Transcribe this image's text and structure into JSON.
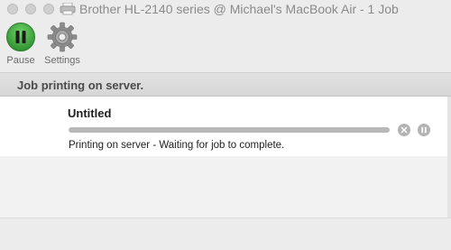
{
  "window": {
    "title": "Brother HL-2140 series @ Michael's MacBook Air - 1 Job",
    "icon": "printer-icon"
  },
  "toolbar": {
    "pause_label": "Pause",
    "pause_icon": "pause-icon",
    "pause_color": "#3aa53a",
    "settings_label": "Settings",
    "settings_icon": "gear-icon"
  },
  "status": {
    "text": "Job printing on server."
  },
  "jobs": [
    {
      "name": "Untitled",
      "progress": 1.0,
      "status_text": "Printing on server - Waiting for job to complete.",
      "cancel_icon": "cancel-icon",
      "hold_icon": "hold-icon"
    }
  ]
}
